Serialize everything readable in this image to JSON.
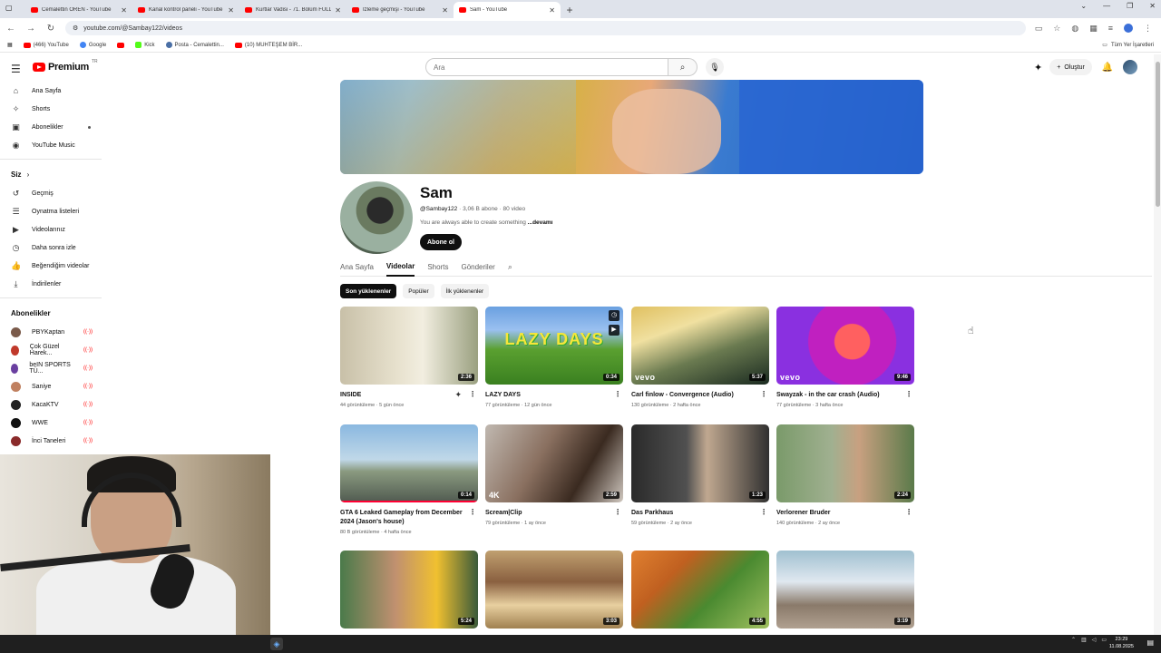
{
  "browser": {
    "tabs": [
      {
        "title": "Cemalettin ÖREN - YouTube",
        "active": false
      },
      {
        "title": "Kanal kontrol paneli - YouTube",
        "active": false
      },
      {
        "title": "Kurtlar Vadisi - 71. Bölüm FULL",
        "active": false
      },
      {
        "title": "İzleme geçmişi - YouTube",
        "active": false
      },
      {
        "title": "Sam - YouTube",
        "active": true
      }
    ],
    "new_tab": "+",
    "url": "youtube.com/@Sambay122/videos",
    "bookmarks": [
      {
        "label": "(466) YouTube",
        "icon": "youtube-icon"
      },
      {
        "label": "Google",
        "icon": "google-icon"
      },
      {
        "label": "",
        "icon": "youtube-icon"
      },
      {
        "label": "Kick",
        "icon": "kick-icon"
      },
      {
        "label": "Posta - Cemalettin...",
        "icon": "mail-icon"
      },
      {
        "label": "(10) MUHTEŞEM BİR...",
        "icon": "youtube-icon"
      }
    ],
    "all_bookmarks": "Tüm Yer İşaretleri"
  },
  "header": {
    "logo_text": "Premium",
    "logo_region": "TR",
    "search_placeholder": "Ara",
    "create_label": "Oluştur"
  },
  "sidebar": {
    "main": [
      {
        "label": "Ana Sayfa",
        "icon": "⌂"
      },
      {
        "label": "Shorts",
        "icon": "✧"
      },
      {
        "label": "Abonelikler",
        "icon": "▣"
      },
      {
        "label": "YouTube Music",
        "icon": "◉"
      }
    ],
    "you_header": "Siz",
    "you": [
      {
        "label": "Geçmiş",
        "icon": "↺"
      },
      {
        "label": "Oynatma listeleri",
        "icon": "☰"
      },
      {
        "label": "Videolarınız",
        "icon": "▶"
      },
      {
        "label": "Daha sonra izle",
        "icon": "◷"
      },
      {
        "label": "Beğendiğim videolar",
        "icon": "👍"
      },
      {
        "label": "İndirilenler",
        "icon": "⤓"
      }
    ],
    "subs_header": "Abonelikler",
    "subs": [
      {
        "label": "PBYKaptan",
        "color": "#7a5a4a"
      },
      {
        "label": "Çok Güzel Harek...",
        "color": "#c0392b"
      },
      {
        "label": "beIN SPORTS TÜ...",
        "color": "#6a3fa0"
      },
      {
        "label": "Saniye",
        "color": "#c08060"
      },
      {
        "label": "KacaKTV",
        "color": "#222222"
      },
      {
        "label": "WWE",
        "color": "#111111"
      },
      {
        "label": "İnci Taneleri",
        "color": "#8a2a2a"
      }
    ]
  },
  "channel": {
    "name": "Sam",
    "handle": "@Sambay122",
    "stats": "· 3,06 B abone · 80 video",
    "description": "You are always able to create something",
    "more": "...devamı",
    "subscribe": "Abone ol",
    "tabs": [
      "Ana Sayfa",
      "Videolar",
      "Shorts",
      "Gönderiler"
    ],
    "active_tab": "Videolar",
    "chips": [
      "Son yüklenenler",
      "Popüler",
      "İlk yüklenenler"
    ]
  },
  "videos": [
    {
      "title": "INSIDE",
      "views": "44 görüntüleme",
      "age": "5 gün önce",
      "duration": "2:36"
    },
    {
      "title": "LAZY DAYS",
      "views": "77 görüntüleme",
      "age": "12 gün önce",
      "duration": "0:34",
      "overlay": "LAZY DAYS"
    },
    {
      "title": "Carl finlow - Convergence (Audio)",
      "views": "130 görüntüleme",
      "age": "2 hafta önce",
      "duration": "5:37",
      "badge": "vevo"
    },
    {
      "title": "Swayzak - in the car crash (Audio)",
      "views": "77 görüntüleme",
      "age": "3 hafta önce",
      "duration": "9:46",
      "badge": "vevo"
    },
    {
      "title": "GTA 6 Leaked Gameplay from December 2024 (Jason's house)",
      "views": "80 B görüntüleme",
      "age": "4 hafta önce",
      "duration": "0:14",
      "progress": 1.0
    },
    {
      "title": "Scream|Clip",
      "views": "79 görüntüleme",
      "age": "1 ay önce",
      "duration": "2:59",
      "badge": "4K"
    },
    {
      "title": "Das Parkhaus",
      "views": "59 görüntüleme",
      "age": "2 ay önce",
      "duration": "1:23"
    },
    {
      "title": "Verlorener Bruder",
      "views": "140 görüntüleme",
      "age": "2 ay önce",
      "duration": "2:24"
    },
    {
      "title": "",
      "views": "",
      "age": "",
      "duration": "5:24"
    },
    {
      "title": "",
      "views": "",
      "age": "",
      "duration": "3:03"
    },
    {
      "title": "",
      "views": "",
      "age": "",
      "duration": "4:55"
    },
    {
      "title": "",
      "views": "",
      "age": "",
      "duration": "3:19"
    }
  ],
  "taskbar": {
    "time": "23:29",
    "date": "11.08.2025"
  }
}
